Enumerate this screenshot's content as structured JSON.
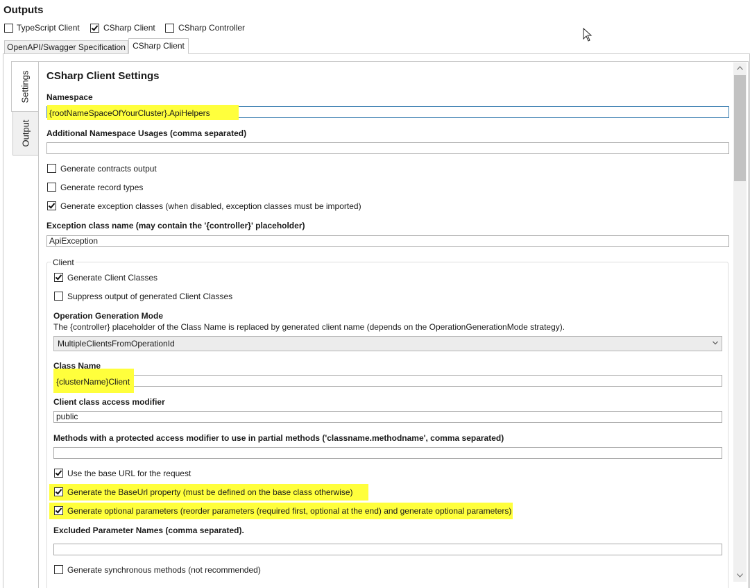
{
  "outputs": {
    "title": "Outputs",
    "options": [
      {
        "label": "TypeScript Client",
        "checked": false
      },
      {
        "label": "CSharp Client",
        "checked": true
      },
      {
        "label": "CSharp Controller",
        "checked": false
      }
    ]
  },
  "top_tabs": [
    {
      "label": "OpenAPI/Swagger Specification",
      "active": false
    },
    {
      "label": "CSharp Client",
      "active": true
    }
  ],
  "side_tabs": [
    {
      "label": "Settings",
      "active": true
    },
    {
      "label": "Output",
      "active": false
    }
  ],
  "settings": {
    "title": "CSharp Client Settings",
    "namespace_label": "Namespace",
    "namespace_value": "{rootNameSpaceOfYourCluster}.ApiHelpers",
    "additional_ns_label": "Additional Namespace Usages (comma separated)",
    "additional_ns_value": "",
    "generate_contracts": "Generate contracts output",
    "generate_records": "Generate record types",
    "generate_exceptions": "Generate exception classes (when disabled, exception classes must be imported)",
    "exception_class_label": "Exception class name (may contain the '{controller}' placeholder)",
    "exception_class_value": "ApiException"
  },
  "client": {
    "group_label": "Client",
    "generate_client_classes": "Generate Client Classes",
    "suppress_output": "Suppress output of generated Client Classes",
    "op_mode_label": "Operation Generation Mode",
    "op_mode_desc": "The {controller} placeholder of the Class Name is replaced by generated client name (depends on the OperationGenerationMode strategy).",
    "op_mode_value": "MultipleClientsFromOperationId",
    "class_name_label": "Class Name",
    "class_name_value": "{clusterName}Client",
    "access_modifier_label": "Client class access modifier",
    "access_modifier_value": "public",
    "protected_methods_label": "Methods with a protected access modifier to use in partial methods ('classname.methodname', comma separated)",
    "protected_methods_value": "",
    "use_base_url": "Use the base URL for the request",
    "generate_base_url": "Generate the BaseUrl property (must be defined on the base class otherwise)",
    "generate_optional": "Generate optional parameters (reorder parameters (required first, optional at the end) and generate optional parameters)",
    "excluded_params_label": "Excluded Parameter Names (comma separated).",
    "excluded_params_value": "",
    "generate_sync": "Generate synchronous methods (not recommended)"
  },
  "colors": {
    "highlight": "#ffff3c",
    "border": "#c8c8c8",
    "scrollbar_thumb": "#c2c2c2"
  }
}
